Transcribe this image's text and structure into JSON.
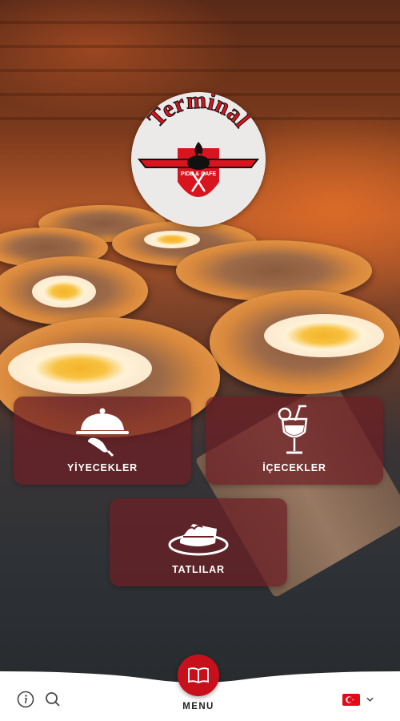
{
  "brand": {
    "logo_title": "Terminal",
    "logo_subtitle": "PIDE & CAFE"
  },
  "categories": [
    {
      "label": "YİYECEKLER",
      "icon": "cloche-icon"
    },
    {
      "label": "İÇECEKLER",
      "icon": "cocktail-icon"
    },
    {
      "label": "TATLILAR",
      "icon": "cake-slice-icon"
    }
  ],
  "bottom_nav": {
    "menu_label": "MENU",
    "menu_icon": "open-book-icon",
    "info_icon": "info-icon",
    "search_icon": "search-icon",
    "language_flag": "turkey-flag-icon"
  },
  "colors": {
    "accent": "#c8101c",
    "card_bg": "rgba(110,30,36,0.72)",
    "bar_bg": "#ffffff"
  }
}
